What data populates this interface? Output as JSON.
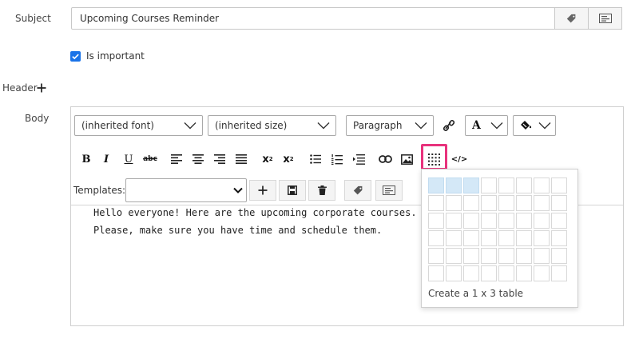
{
  "form": {
    "subject_label": "Subject",
    "subject_value": "Upcoming Courses Reminder",
    "important_label": "Is important",
    "header_label": "Header",
    "body_label": "Body"
  },
  "toolbar": {
    "font_family": "(inherited font)",
    "font_size": "(inherited size)",
    "block_format": "Paragraph",
    "font_color_glyph": "A",
    "bold": "B",
    "italic": "I",
    "underline": "U",
    "strike": "abc",
    "subscript": "x",
    "subscript_mark": "2",
    "superscript": "x",
    "superscript_mark": "2",
    "code_view": "</>",
    "templates_label": "Templates:"
  },
  "body_content": {
    "line1": "Hello everyone! Here are the upcoming corporate courses.",
    "line2": "Please, make sure you have time and schedule them."
  },
  "table_picker": {
    "rows": 6,
    "cols": 8,
    "selected_rows": 1,
    "selected_cols": 3,
    "caption": "Create a 1 x 3 table"
  },
  "colors": {
    "accent": "#1a73e8",
    "highlight": "#e8327c",
    "cell_selected": "#d4e8f7"
  }
}
